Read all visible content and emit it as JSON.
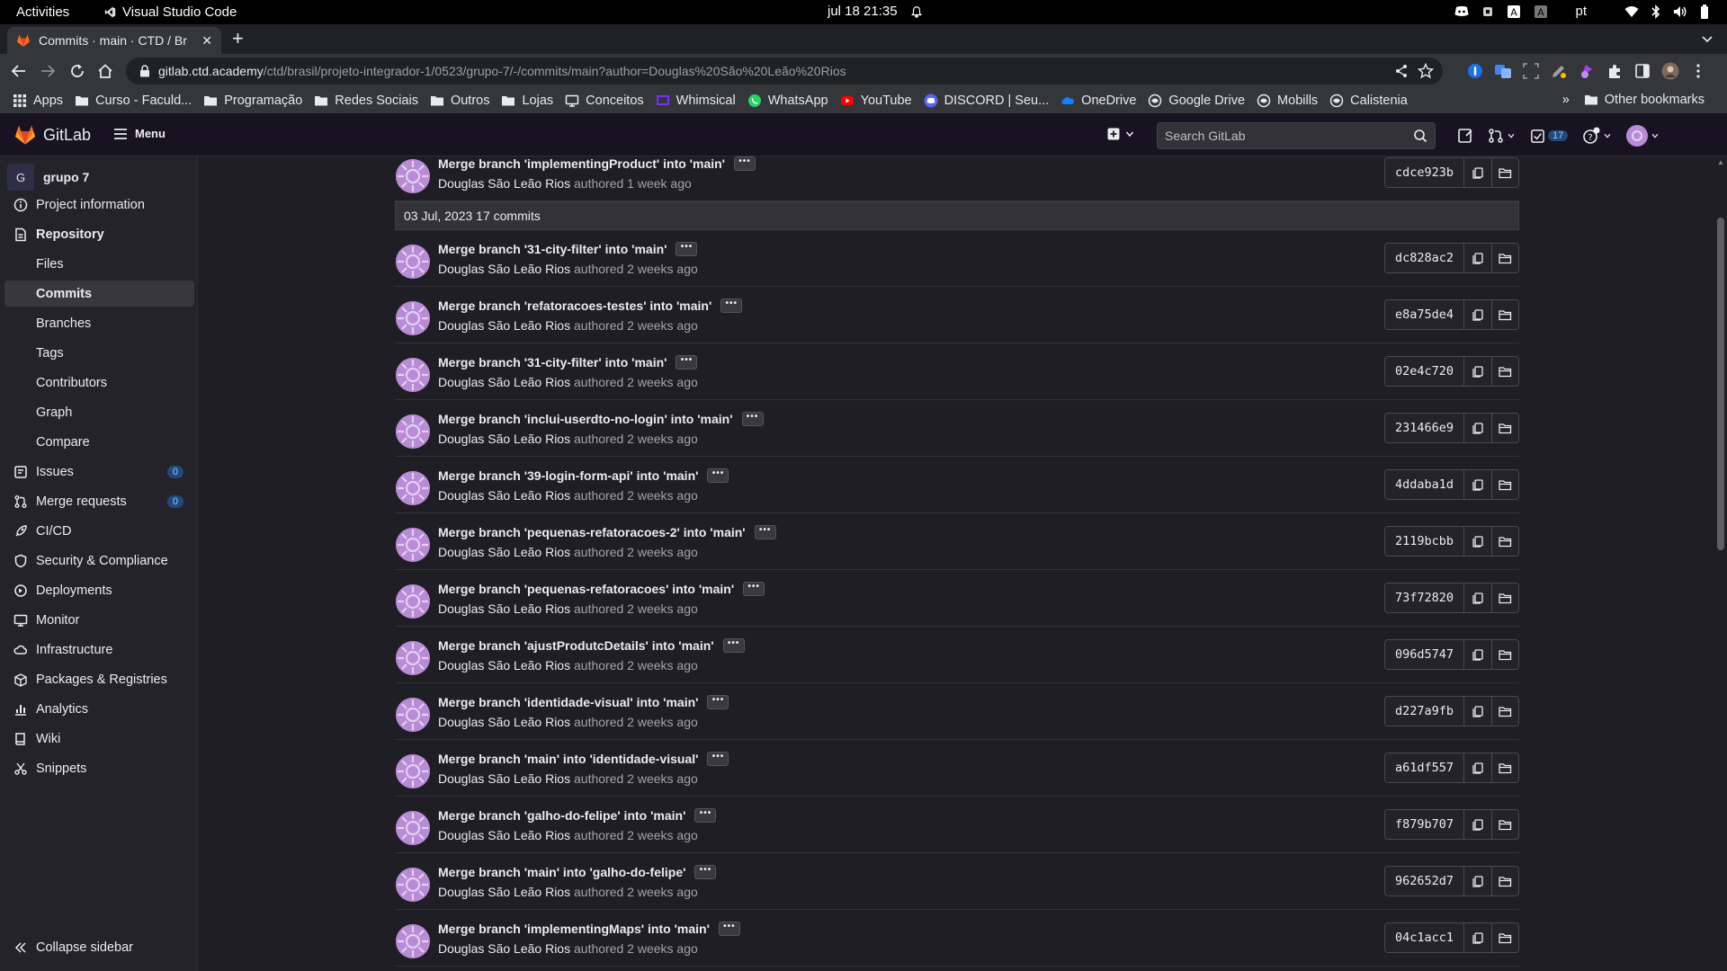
{
  "os_bar": {
    "activities": "Activities",
    "app_name": "Visual Studio Code",
    "clock": "jul 18  21:35",
    "lang": "pt"
  },
  "browser": {
    "tab_title": "Commits · main · CTD / Br",
    "url_host": "gitlab.ctd.academy",
    "url_path": "/ctd/brasil/projeto-integrador-1/0523/grupo-7/-/commits/main?author=Douglas%20São%20Leão%20Rios",
    "bookmarks": [
      {
        "label": "Apps",
        "icon": "apps-grid-icon"
      },
      {
        "label": "Curso - Faculd...",
        "icon": "folder-icon"
      },
      {
        "label": "Programação",
        "icon": "folder-icon"
      },
      {
        "label": "Redes Sociais",
        "icon": "folder-icon"
      },
      {
        "label": "Outros",
        "icon": "folder-icon"
      },
      {
        "label": "Lojas",
        "icon": "folder-icon"
      },
      {
        "label": "Conceitos",
        "icon": "monitor-icon"
      },
      {
        "label": "Whimsical",
        "icon": "whimsical-icon"
      },
      {
        "label": "WhatsApp",
        "icon": "whatsapp-icon"
      },
      {
        "label": "YouTube",
        "icon": "youtube-icon"
      },
      {
        "label": "DISCORD | Seu...",
        "icon": "discord-icon"
      },
      {
        "label": "OneDrive",
        "icon": "onedrive-icon"
      },
      {
        "label": "Google Drive",
        "icon": "globe-icon"
      },
      {
        "label": "Mobills",
        "icon": "globe-icon"
      },
      {
        "label": "Calistenia",
        "icon": "globe-icon"
      }
    ],
    "overflow": "»",
    "other_bookmarks": "Other bookmarks"
  },
  "gitlab": {
    "brand": "GitLab",
    "menu_label": "Menu",
    "search_placeholder": "Search GitLab",
    "todo_count": "17"
  },
  "sidebar": {
    "project_initial": "G",
    "project_name": "grupo 7",
    "items": [
      {
        "label": "Project information",
        "icon": "info-icon"
      },
      {
        "label": "Repository",
        "icon": "document-icon"
      },
      {
        "label": "Files"
      },
      {
        "label": "Commits"
      },
      {
        "label": "Branches"
      },
      {
        "label": "Tags"
      },
      {
        "label": "Contributors"
      },
      {
        "label": "Graph"
      },
      {
        "label": "Compare"
      },
      {
        "label": "Issues",
        "icon": "issues-icon",
        "badge": "0"
      },
      {
        "label": "Merge requests",
        "icon": "merge-request-icon",
        "badge": "0"
      },
      {
        "label": "CI/CD",
        "icon": "rocket-icon"
      },
      {
        "label": "Security & Compliance",
        "icon": "shield-icon"
      },
      {
        "label": "Deployments",
        "icon": "deployments-icon"
      },
      {
        "label": "Monitor",
        "icon": "monitor-icon"
      },
      {
        "label": "Infrastructure",
        "icon": "cloud-icon"
      },
      {
        "label": "Packages & Registries",
        "icon": "package-icon"
      },
      {
        "label": "Analytics",
        "icon": "chart-icon"
      },
      {
        "label": "Wiki",
        "icon": "book-icon"
      },
      {
        "label": "Snippets",
        "icon": "scissors-icon"
      }
    ],
    "collapse_label": "Collapse sidebar"
  },
  "commits": {
    "first": {
      "message": "Merge branch 'implementingProduct' into 'main'",
      "author": "Douglas São Leão Rios",
      "when": "authored 1 week ago",
      "sha": "cdce923b"
    },
    "day_header": "03 Jul, 2023 17 commits",
    "list": [
      {
        "message": "Merge branch '31-city-filter' into 'main'",
        "author": "Douglas São Leão Rios",
        "when": "authored 2 weeks ago",
        "sha": "dc828ac2"
      },
      {
        "message": "Merge branch 'refatoracoes-testes' into 'main'",
        "author": "Douglas São Leão Rios",
        "when": "authored 2 weeks ago",
        "sha": "e8a75de4"
      },
      {
        "message": "Merge branch '31-city-filter' into 'main'",
        "author": "Douglas São Leão Rios",
        "when": "authored 2 weeks ago",
        "sha": "02e4c720"
      },
      {
        "message": "Merge branch 'inclui-userdto-no-login' into 'main'",
        "author": "Douglas São Leão Rios",
        "when": "authored 2 weeks ago",
        "sha": "231466e9"
      },
      {
        "message": "Merge branch '39-login-form-api' into 'main'",
        "author": "Douglas São Leão Rios",
        "when": "authored 2 weeks ago",
        "sha": "4ddaba1d"
      },
      {
        "message": "Merge branch 'pequenas-refatoracoes-2' into 'main'",
        "author": "Douglas São Leão Rios",
        "when": "authored 2 weeks ago",
        "sha": "2119bcbb"
      },
      {
        "message": "Merge branch 'pequenas-refatoracoes' into 'main'",
        "author": "Douglas São Leão Rios",
        "when": "authored 2 weeks ago",
        "sha": "73f72820"
      },
      {
        "message": "Merge branch 'ajustProdutcDetails' into 'main'",
        "author": "Douglas São Leão Rios",
        "when": "authored 2 weeks ago",
        "sha": "096d5747"
      },
      {
        "message": "Merge branch 'identidade-visual' into 'main'",
        "author": "Douglas São Leão Rios",
        "when": "authored 2 weeks ago",
        "sha": "d227a9fb"
      },
      {
        "message": "Merge branch 'main' into 'identidade-visual'",
        "author": "Douglas São Leão Rios",
        "when": "authored 2 weeks ago",
        "sha": "a61df557"
      },
      {
        "message": "Merge branch 'galho-do-felipe' into 'main'",
        "author": "Douglas São Leão Rios",
        "when": "authored 2 weeks ago",
        "sha": "f879b707"
      },
      {
        "message": "Merge branch 'main' into 'galho-do-felipe'",
        "author": "Douglas São Leão Rios",
        "when": "authored 2 weeks ago",
        "sha": "962652d7"
      },
      {
        "message": "Merge branch 'implementingMaps' into 'main'",
        "author": "Douglas São Leão Rios",
        "when": "authored 2 weeks ago",
        "sha": "04c1acc1"
      }
    ]
  },
  "colors": {
    "avatar": "#b88bd6",
    "gitlab_orange": "#fc6d26",
    "badge_bg": "#1f4a7c"
  }
}
